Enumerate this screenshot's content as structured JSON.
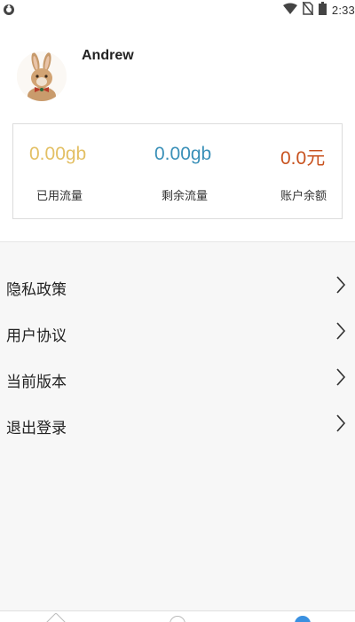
{
  "status_bar": {
    "time": "2:33",
    "icons": [
      "sync-icon",
      "wifi-icon",
      "no-sim-icon",
      "battery-icon"
    ]
  },
  "profile": {
    "username": "Andrew",
    "avatar_icon": "rabbit-avatar-icon"
  },
  "stats": [
    {
      "value": "0.00gb",
      "label": "已用流量",
      "color": "#e3c065"
    },
    {
      "value": "0.00gb",
      "label": "剩余流量",
      "color": "#3a90b8"
    },
    {
      "value": "0.0元",
      "label": "账户余额",
      "color": "#c8521e"
    }
  ],
  "menu": {
    "items": [
      {
        "label": "隐私政策",
        "icon": "chevron-right-icon"
      },
      {
        "label": "用户协议",
        "icon": "chevron-right-icon"
      },
      {
        "label": "当前版本",
        "icon": "chevron-right-icon"
      },
      {
        "label": "退出登录",
        "icon": "chevron-right-icon"
      }
    ]
  },
  "bottom_nav": {
    "icons": [
      "home-icon",
      "discover-icon",
      "profile-icon"
    ],
    "active_color": "#3a90e0"
  }
}
